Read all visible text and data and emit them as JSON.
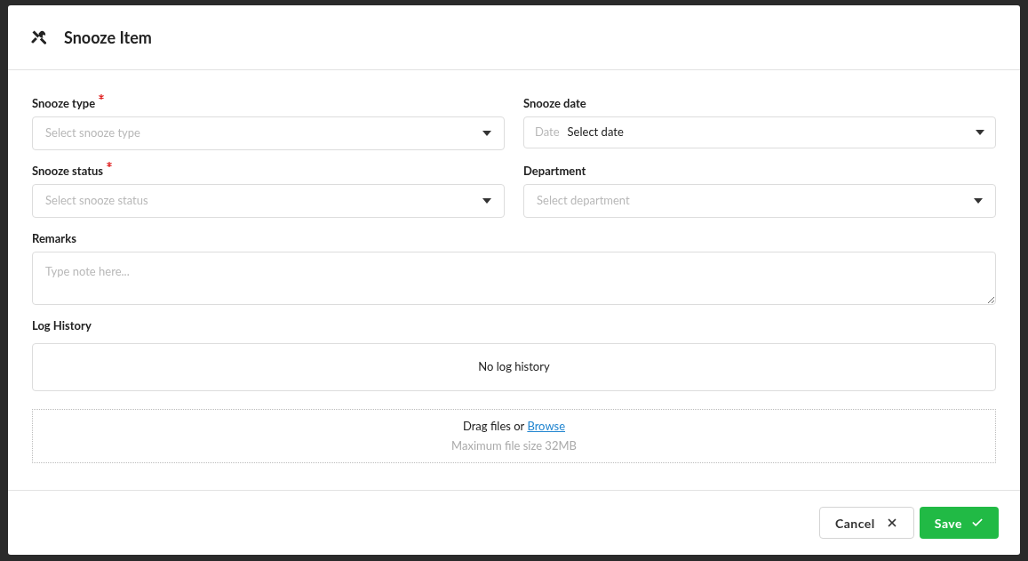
{
  "dialog": {
    "title": "Snooze Item"
  },
  "fields": [
    {
      "kind": "select",
      "label": "Snooze type",
      "required": true,
      "placeholder": "Select snooze type"
    },
    {
      "kind": "date",
      "label": "Snooze date",
      "required": false,
      "prefix": "Date",
      "value": "Select date"
    },
    {
      "kind": "select",
      "label": "Snooze status",
      "required": true,
      "placeholder": "Select snooze status"
    },
    {
      "kind": "select",
      "label": "Department",
      "required": false,
      "placeholder": "Select department"
    }
  ],
  "remarks": {
    "label": "Remarks",
    "placeholder": "Type note here..."
  },
  "log_history": {
    "label": "Log History",
    "empty_text": "No log history"
  },
  "upload": {
    "text": "Drag files or",
    "link": "Browse",
    "hint": "Maximum file size 32MB"
  },
  "buttons": [
    {
      "kind": "cancel",
      "label": "Cancel"
    },
    {
      "kind": "save",
      "label": "Save"
    }
  ]
}
